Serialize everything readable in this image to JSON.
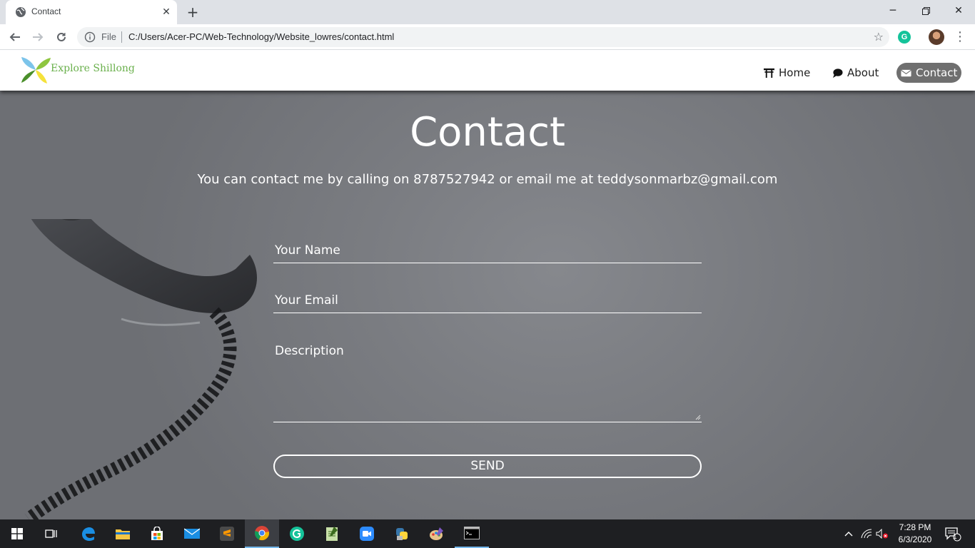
{
  "browser": {
    "tab_title": "Contact",
    "file_label": "File",
    "url": "C:/Users/Acer-PC/Web-Technology/Website_lowres/contact.html",
    "extension_letter": "G"
  },
  "site": {
    "brand": "Explore Shillong",
    "nav": [
      {
        "label": "Home",
        "icon": "torii-icon"
      },
      {
        "label": "About",
        "icon": "speech-bubble-icon"
      },
      {
        "label": "Contact",
        "icon": "envelope-icon",
        "active": true
      }
    ]
  },
  "contact": {
    "title": "Contact",
    "subtitle": "You can contact me by calling on 8787527942 or email me at teddysonmarbz@gmail.com",
    "name_placeholder": "Your Name",
    "email_placeholder": "Your Email",
    "description_placeholder": "Description",
    "send_label": "SEND"
  },
  "taskbar": {
    "time": "7:28 PM",
    "date": "6/3/2020",
    "notification_count": "1"
  },
  "colors": {
    "nav_active_bg": "#6f6f6f",
    "brand_green": "#6ab04c",
    "taskbar_bg": "#1e1f22"
  }
}
